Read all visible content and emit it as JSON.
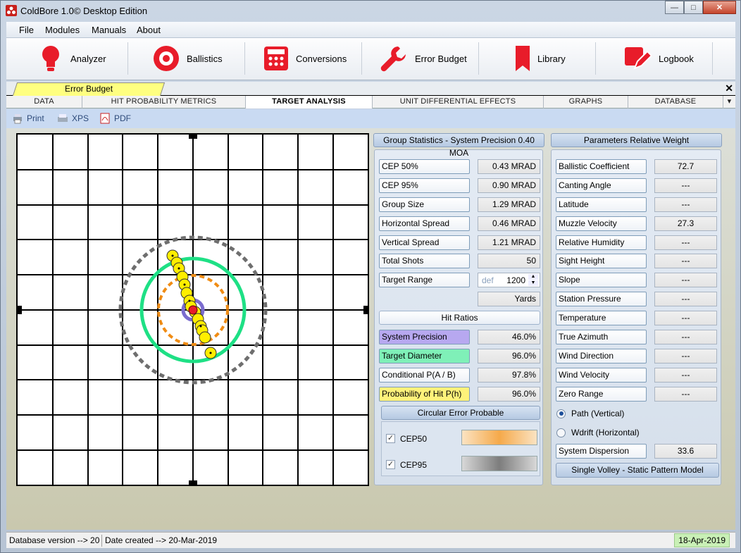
{
  "window": {
    "title": "ColdBore 1.0© Desktop Edition",
    "minimize": "—",
    "maximize": "□",
    "close": "✕"
  },
  "menu": [
    "File",
    "Modules",
    "Manuals",
    "About"
  ],
  "toolbar": [
    {
      "label": "Analyzer",
      "icon": "lightbulb-icon"
    },
    {
      "label": "Ballistics",
      "icon": "target-icon"
    },
    {
      "label": "Conversions",
      "icon": "calculator-icon"
    },
    {
      "label": "Error Budget",
      "icon": "wrench-icon"
    },
    {
      "label": "Library",
      "icon": "bookmark-icon"
    },
    {
      "label": "Logbook",
      "icon": "edit-icon"
    }
  ],
  "doc_tab": "Error Budget",
  "tabs": [
    "DATA",
    "HIT PROBABILITY METRICS",
    "TARGET ANALYSIS",
    "UNIT DIFFERENTIAL EFFECTS",
    "GRAPHS",
    "DATABASE"
  ],
  "active_tab": "TARGET ANALYSIS",
  "print_bar": [
    "Print",
    "XPS",
    "PDF"
  ],
  "group_stats": {
    "header": "Group Statistics - System Precision 0.40 MOA",
    "rows": [
      {
        "label": "CEP 50%",
        "value": "0.43 MRAD"
      },
      {
        "label": "CEP 95%",
        "value": "0.90 MRAD"
      },
      {
        "label": "Group Size",
        "value": "1.29 MRAD"
      },
      {
        "label": "Horizontal Spread",
        "value": "0.46 MRAD"
      },
      {
        "label": "Vertical Spread",
        "value": "1.21 MRAD"
      },
      {
        "label": "Total Shots",
        "value": "50"
      }
    ],
    "target_range_label": "Target Range",
    "target_range_hint": "def",
    "target_range_value": "1200",
    "units": "Yards",
    "hit_ratios_header": "Hit Ratios",
    "hit_ratios": [
      {
        "label": "System Precision",
        "value": "46.0%",
        "color": "#b7a8f0"
      },
      {
        "label": "Target Diameter",
        "value": "96.0%",
        "color": "#7ff0b8"
      },
      {
        "label": "Conditional P(A / B)",
        "value": "97.8%",
        "color": ""
      },
      {
        "label": "Probability of Hit P(h)",
        "value": "96.0%",
        "color": "#fff27a"
      }
    ],
    "cep_header": "Circular Error Probable",
    "cep_items": [
      {
        "label": "CEP50",
        "checked": true,
        "swatch": "#f5a94a"
      },
      {
        "label": "CEP95",
        "checked": true,
        "swatch": "#7d7d7d"
      }
    ]
  },
  "params": {
    "header": "Parameters Relative Weight",
    "rows": [
      {
        "label": "Ballistic Coefficient",
        "value": "72.7"
      },
      {
        "label": "Canting Angle",
        "value": "---"
      },
      {
        "label": "Latitude",
        "value": "---"
      },
      {
        "label": "Muzzle Velocity",
        "value": "27.3"
      },
      {
        "label": "Relative Humidity",
        "value": "---"
      },
      {
        "label": "Sight Height",
        "value": "---"
      },
      {
        "label": "Slope",
        "value": "---"
      },
      {
        "label": "Station Pressure",
        "value": "---"
      },
      {
        "label": "Temperature",
        "value": "---"
      },
      {
        "label": "True Azimuth",
        "value": "---"
      },
      {
        "label": "Wind Direction",
        "value": "---"
      },
      {
        "label": "Wind Velocity",
        "value": "---"
      },
      {
        "label": "Zero Range",
        "value": "---"
      }
    ],
    "radio_vertical": "Path (Vertical)",
    "radio_horizontal": "Wdrift (Horizontal)",
    "dispersion_label": "System Dispersion",
    "dispersion_value": "33.6",
    "model_button": "Single Volley - Static Pattern Model"
  },
  "status": {
    "db_version": "Database version --> 20",
    "date_created": "Date created --> 20-Mar-2019",
    "today": "18-Apr-2019"
  },
  "colors": {
    "cep50": "#f08c14",
    "cep95": "#6e6e6e",
    "target": "#1ee085",
    "precision": "#7b6ccf",
    "shot": "#ffee00"
  }
}
